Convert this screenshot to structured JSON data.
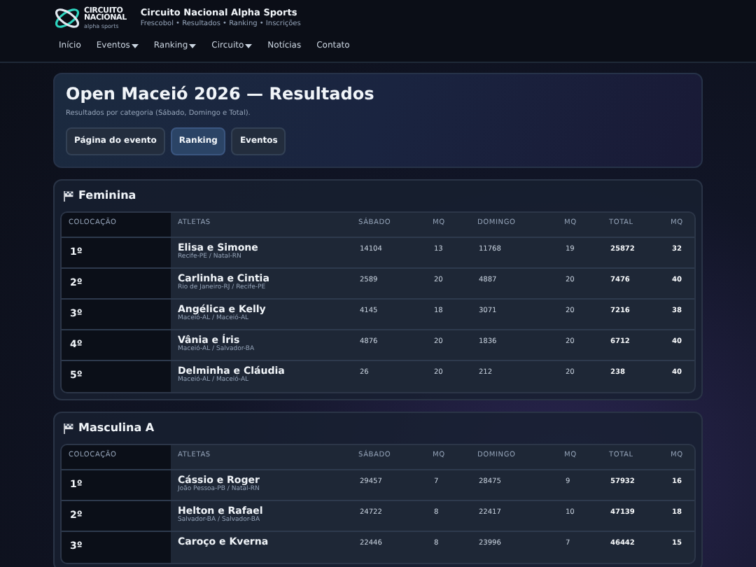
{
  "brand": {
    "logo_line1": "CIRCUITO",
    "logo_line2": "NACIONAL",
    "logo_tag": "alpha sports",
    "title": "Circuito Nacional Alpha Sports",
    "subtitle": "Frescobol • Resultados • Ranking • Inscrições"
  },
  "nav": [
    {
      "label": "Início",
      "has_menu": false
    },
    {
      "label": "Eventos",
      "has_menu": true
    },
    {
      "label": "Ranking",
      "has_menu": true
    },
    {
      "label": "Circuito",
      "has_menu": true
    },
    {
      "label": "Notícias",
      "has_menu": false
    },
    {
      "label": "Contato",
      "has_menu": false
    }
  ],
  "hero": {
    "title": "Open Maceió 2026 — Resultados",
    "subtitle": "Resultados por categoria (Sábado, Domingo e Total).",
    "buttons": [
      {
        "label": "Página do evento",
        "selected": false
      },
      {
        "label": "Ranking",
        "selected": true
      },
      {
        "label": "Eventos",
        "selected": false
      }
    ]
  },
  "categories": [
    {
      "title": "Feminina",
      "columns": [
        "COLOCAÇÃO",
        "ATLETAS",
        "SÁBADO",
        "MQ",
        "DOMINGO",
        "MQ",
        "TOTAL",
        "MQ"
      ],
      "rows": [
        {
          "place": "1º",
          "names": "Elisa e Simone",
          "cities": "Recife-PE / Natal-RN",
          "sat": "14104",
          "sat_mq": "13",
          "sun": "11768",
          "sun_mq": "19",
          "total": "25872",
          "total_mq": "32"
        },
        {
          "place": "2º",
          "names": "Carlinha e Cintia",
          "cities": "Rio de Janeiro-RJ / Recife-PE",
          "sat": "2589",
          "sat_mq": "20",
          "sun": "4887",
          "sun_mq": "20",
          "total": "7476",
          "total_mq": "40"
        },
        {
          "place": "3º",
          "names": "Angélica e Kelly",
          "cities": "Maceió-AL / Maceió-AL",
          "sat": "4145",
          "sat_mq": "18",
          "sun": "3071",
          "sun_mq": "20",
          "total": "7216",
          "total_mq": "38"
        },
        {
          "place": "4º",
          "names": "Vânia e Íris",
          "cities": "Maceió-AL / Salvador-BA",
          "sat": "4876",
          "sat_mq": "20",
          "sun": "1836",
          "sun_mq": "20",
          "total": "6712",
          "total_mq": "40"
        },
        {
          "place": "5º",
          "names": "Delminha e Cláudia",
          "cities": "Maceió-AL / Maceió-AL",
          "sat": "26",
          "sat_mq": "20",
          "sun": "212",
          "sun_mq": "20",
          "total": "238",
          "total_mq": "40"
        }
      ]
    },
    {
      "title": "Masculina A",
      "columns": [
        "COLOCAÇÃO",
        "ATLETAS",
        "SÁBADO",
        "MQ",
        "DOMINGO",
        "MQ",
        "TOTAL",
        "MQ"
      ],
      "rows": [
        {
          "place": "1º",
          "names": "Cássio e Roger",
          "cities": "João Pessoa-PB / Natal-RN",
          "sat": "29457",
          "sat_mq": "7",
          "sun": "28475",
          "sun_mq": "9",
          "total": "57932",
          "total_mq": "16"
        },
        {
          "place": "2º",
          "names": "Helton e Rafael",
          "cities": "Salvador-BA / Salvador-BA",
          "sat": "24722",
          "sat_mq": "8",
          "sun": "22417",
          "sun_mq": "10",
          "total": "47139",
          "total_mq": "18"
        },
        {
          "place": "3º",
          "names": "Caroço e Kverna",
          "sat": "22446",
          "sat_mq": "8",
          "sun": "23996",
          "sun_mq": "7",
          "total": "46442",
          "total_mq": "15"
        }
      ]
    }
  ]
}
